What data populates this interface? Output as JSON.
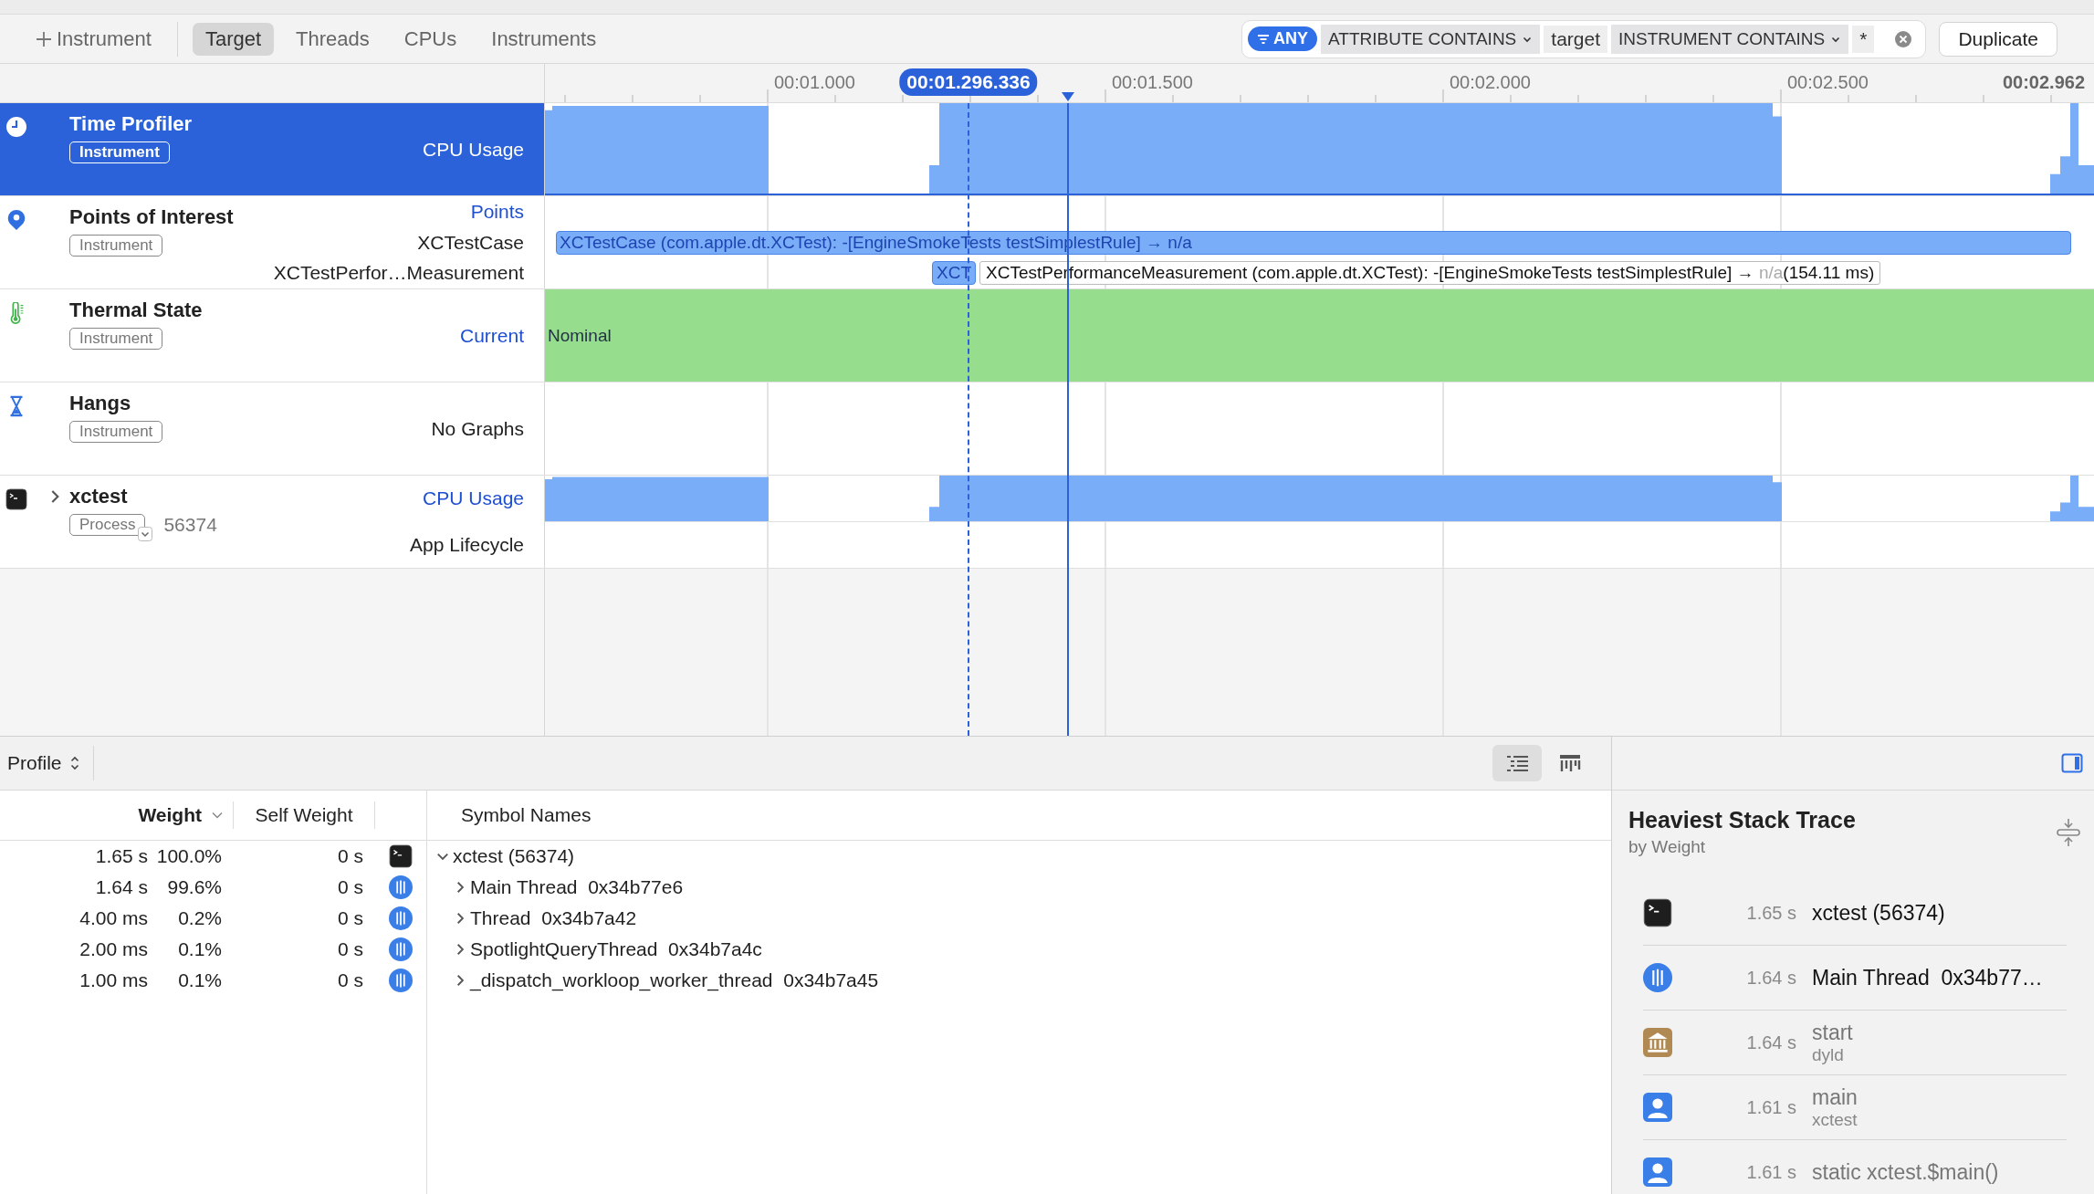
{
  "toolbar": {
    "add_label": "Instrument",
    "tabs": [
      {
        "label": "Target",
        "selected": true
      },
      {
        "label": "Threads",
        "selected": false
      },
      {
        "label": "CPUs",
        "selected": false
      },
      {
        "label": "Instruments",
        "selected": false
      }
    ],
    "filter": {
      "match": "ANY",
      "tokens": [
        {
          "kind": "field",
          "label": "ATTRIBUTE CONTAINS"
        },
        {
          "kind": "value",
          "label": "target"
        },
        {
          "kind": "field",
          "label": "INSTRUMENT CONTAINS"
        },
        {
          "kind": "value",
          "label": "*"
        }
      ]
    },
    "action_button": "Duplicate"
  },
  "ruler": {
    "ticks": [
      "00:01.000",
      "00:01.500",
      "00:02.000",
      "00:02.500"
    ],
    "hover_time": "00:01.296.336",
    "end_time": "00:02.962"
  },
  "tracks": [
    {
      "kind": "profiler",
      "name": "Time Profiler",
      "badge": "Instrument",
      "selected": true,
      "lane_labels": [
        {
          "kind": "graph",
          "text": "CPU Usage"
        }
      ]
    },
    {
      "kind": "points",
      "name": "Points of Interest",
      "badge": "Instrument",
      "selected": false,
      "lane_labels": [
        {
          "kind": "graph",
          "text": "Points"
        },
        {
          "kind": "series",
          "text": "XCTestCase"
        },
        {
          "kind": "series",
          "text": "XCTestPerfor…Measurement"
        }
      ],
      "intervals": [
        {
          "text": "XCTestCase (com.apple.dt.XCTest): -[EngineSmokeTests testSimplestRule] → n/a"
        },
        {
          "short": "XCT",
          "text": "XCTestPerformanceMeasurement (com.apple.dt.XCTest): -[EngineSmokeTests testSimplestRule] →",
          "dim": "n/a",
          "duration": "(154.11 ms)"
        }
      ]
    },
    {
      "kind": "thermal",
      "name": "Thermal State",
      "badge": "Instrument",
      "selected": false,
      "lane_labels": [
        {
          "kind": "graph",
          "text": "Current"
        }
      ],
      "state": "Nominal"
    },
    {
      "kind": "hangs",
      "name": "Hangs",
      "badge": "Instrument",
      "selected": false,
      "lane_labels": [
        {
          "kind": "series",
          "text": "No Graphs"
        }
      ]
    },
    {
      "kind": "process",
      "name": "xctest",
      "badge": "Process",
      "pid": "56374",
      "expanded": false,
      "selected": false,
      "lane_labels": [
        {
          "kind": "graph",
          "text": "CPU Usage"
        },
        {
          "kind": "series",
          "text": "App Lifecycle"
        }
      ]
    }
  ],
  "detail": {
    "view_selector": "Profile",
    "view_modes": [
      {
        "kind": "list",
        "selected": true
      },
      {
        "kind": "tree",
        "selected": false
      }
    ],
    "columns": [
      "Weight",
      "Self Weight",
      "Symbol Names"
    ],
    "rows": [
      {
        "kind": "process",
        "weight": "1.65 s",
        "percent": "100.0%",
        "self_weight": "0 s",
        "symbol": "xctest (56374)",
        "expanded": true,
        "children": [
          {
            "kind": "thread",
            "weight": "1.64 s",
            "percent": "99.6%",
            "self_weight": "0 s",
            "symbol": "Main Thread  0x34b77e6",
            "expanded": false
          },
          {
            "kind": "thread",
            "weight": "4.00 ms",
            "percent": "0.2%",
            "self_weight": "0 s",
            "symbol": "Thread  0x34b7a42",
            "expanded": false
          },
          {
            "kind": "thread",
            "weight": "2.00 ms",
            "percent": "0.1%",
            "self_weight": "0 s",
            "symbol": "SpotlightQueryThread  0x34b7a4c",
            "expanded": false
          },
          {
            "kind": "thread",
            "weight": "1.00 ms",
            "percent": "0.1%",
            "self_weight": "0 s",
            "symbol": "_dispatch_workloop_worker_thread  0x34b7a45",
            "expanded": false
          }
        ]
      }
    ]
  },
  "inspector": {
    "title": "Heaviest Stack Trace",
    "subtitle": "by Weight",
    "frames": [
      {
        "kind": "process",
        "weight": "1.65 s",
        "name": "xctest (56374)",
        "dimmed": false
      },
      {
        "kind": "thread",
        "weight": "1.64 s",
        "name": "Main Thread  0x34b77…",
        "dimmed": false
      },
      {
        "kind": "library",
        "weight": "1.64 s",
        "name": "start",
        "library": "dyld",
        "dimmed": true
      },
      {
        "kind": "user",
        "weight": "1.61 s",
        "name": "main",
        "library": "xctest",
        "dimmed": true
      },
      {
        "kind": "user",
        "weight": "1.61 s",
        "name": "static xctest.$main()",
        "dimmed": true
      }
    ]
  }
}
